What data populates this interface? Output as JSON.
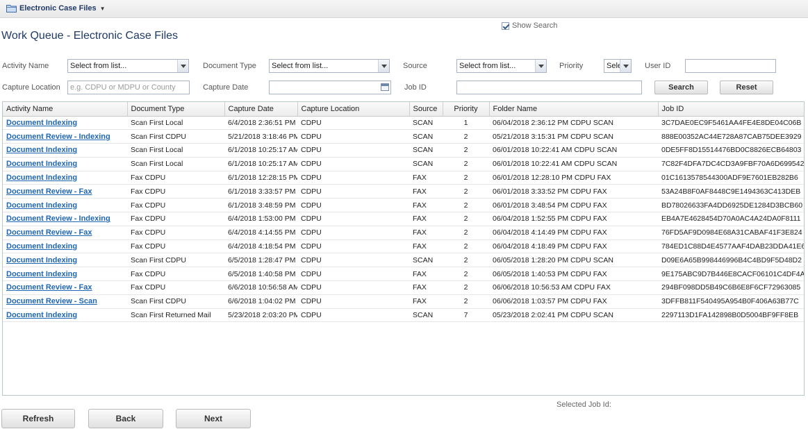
{
  "app": {
    "menu_label": "Electronic Case Files"
  },
  "page": {
    "title": "Work Queue - Electronic Case Files",
    "show_search_label": "Show Search",
    "show_search_checked": true
  },
  "filters": {
    "activity_name": {
      "label": "Activity Name",
      "value": "Select from list..."
    },
    "document_type": {
      "label": "Document Type",
      "value": "Select from list..."
    },
    "source": {
      "label": "Source",
      "value": "Select from list..."
    },
    "priority": {
      "label": "Priority",
      "value": "Sele"
    },
    "user_id": {
      "label": "User ID",
      "value": ""
    },
    "capture_location": {
      "label": "Capture Location",
      "placeholder": "e.g. CDPU or MDPU or County",
      "value": ""
    },
    "capture_date": {
      "label": "Capture Date",
      "value": ""
    },
    "job_id": {
      "label": "Job ID",
      "value": ""
    },
    "search_label": "Search",
    "reset_label": "Reset"
  },
  "grid": {
    "columns": [
      "Activity Name",
      "Document Type",
      "Capture Date",
      "Capture Location",
      "Source",
      "Priority",
      "Folder Name",
      "Job ID"
    ],
    "rows": [
      [
        "Document Indexing",
        "Scan First Local",
        "6/4/2018 2:36:51 PM",
        "CDPU",
        "SCAN",
        "1",
        "06/04/2018 2:36:12 PM CDPU SCAN",
        "3C7DAE0EC9F5461AA4FE4E8DE04C06B"
      ],
      [
        "Document Review - Indexing",
        "Scan First CDPU",
        "5/21/2018 3:18:46 PM",
        "CDPU",
        "SCAN",
        "2",
        "05/21/2018 3:15:31 PM CDPU SCAN",
        "888E00352AC44E728A87CAB75DEE3929"
      ],
      [
        "Document Indexing",
        "Scan First Local",
        "6/1/2018 10:25:17 AM",
        "CDPU",
        "SCAN",
        "2",
        "06/01/2018 10:22:41 AM CDPU SCAN",
        "0DE5FF8D15514476BD0C8826ECB64803"
      ],
      [
        "Document Indexing",
        "Scan First Local",
        "6/1/2018 10:25:17 AM",
        "CDPU",
        "SCAN",
        "2",
        "06/01/2018 10:22:41 AM CDPU SCAN",
        "7C82F4DFA7DC4CD3A9FBF70A6D699542"
      ],
      [
        "Document Indexing",
        "Fax CDPU",
        "6/1/2018 12:28:15 PM",
        "CDPU",
        "FAX",
        "2",
        "06/01/2018 12:28:10 PM CDPU FAX",
        "01C1613578544300ADF9E7601EB282B6"
      ],
      [
        "Document Review - Fax",
        "Fax CDPU",
        "6/1/2018 3:33:57 PM",
        "CDPU",
        "FAX",
        "2",
        "06/01/2018 3:33:52 PM CDPU FAX",
        "53A24B8F0AF8448C9E1494363C413DEB"
      ],
      [
        "Document Indexing",
        "Fax CDPU",
        "6/1/2018 3:48:59 PM",
        "CDPU",
        "FAX",
        "2",
        "06/01/2018 3:48:54 PM CDPU FAX",
        "BD78026633FA4DD6925DE1284D3BCB60"
      ],
      [
        "Document Review - Indexing",
        "Fax CDPU",
        "6/4/2018 1:53:00 PM",
        "CDPU",
        "FAX",
        "2",
        "06/04/2018 1:52:55 PM CDPU FAX",
        "EB4A7E4628454D70A0AC4A24DA0F8111"
      ],
      [
        "Document Review - Fax",
        "Fax CDPU",
        "6/4/2018 4:14:55 PM",
        "CDPU",
        "FAX",
        "2",
        "06/04/2018 4:14:49 PM CDPU FAX",
        "76FD5AF9D0984E68A31CABAF41F3E824"
      ],
      [
        "Document Indexing",
        "Fax CDPU",
        "6/4/2018 4:18:54 PM",
        "CDPU",
        "FAX",
        "2",
        "06/04/2018 4:18:49 PM CDPU FAX",
        "784ED1C88D4E4577AAF4DAB23DDA41E6"
      ],
      [
        "Document Indexing",
        "Scan First CDPU",
        "6/5/2018 1:28:47 PM",
        "CDPU",
        "SCAN",
        "2",
        "06/05/2018 1:28:20 PM CDPU SCAN",
        "D09E6A65B998446996B4C4BD9F5D48D2"
      ],
      [
        "Document Indexing",
        "Fax CDPU",
        "6/5/2018 1:40:58 PM",
        "CDPU",
        "FAX",
        "2",
        "06/05/2018 1:40:53 PM CDPU FAX",
        "9E175ABC9D7B446E8CACF06101C4DF4A"
      ],
      [
        "Document Review - Fax",
        "Fax CDPU",
        "6/6/2018 10:56:58 AM",
        "CDPU",
        "FAX",
        "2",
        "06/06/2018 10:56:53 AM CDPU FAX",
        "294BF098DD5B49C6B6E8F6CF72963085"
      ],
      [
        "Document Review - Scan",
        "Scan First CDPU",
        "6/6/2018 1:04:02 PM",
        "CDPU",
        "FAX",
        "2",
        "06/06/2018 1:03:57 PM CDPU FAX",
        "3DFFB811F540495A954B0F406A63B77C"
      ],
      [
        "Document Indexing",
        "Scan First Returned Mail",
        "5/23/2018 2:03:20 PM",
        "CDPU",
        "SCAN",
        "7",
        "05/23/2018 2:02:41 PM CDPU SCAN",
        "2297113D1FA142898B0D5004BF9FF8EB"
      ]
    ]
  },
  "footer": {
    "selected_job_label": "Selected Job Id:",
    "refresh_label": "Refresh",
    "back_label": "Back",
    "next_label": "Next"
  }
}
